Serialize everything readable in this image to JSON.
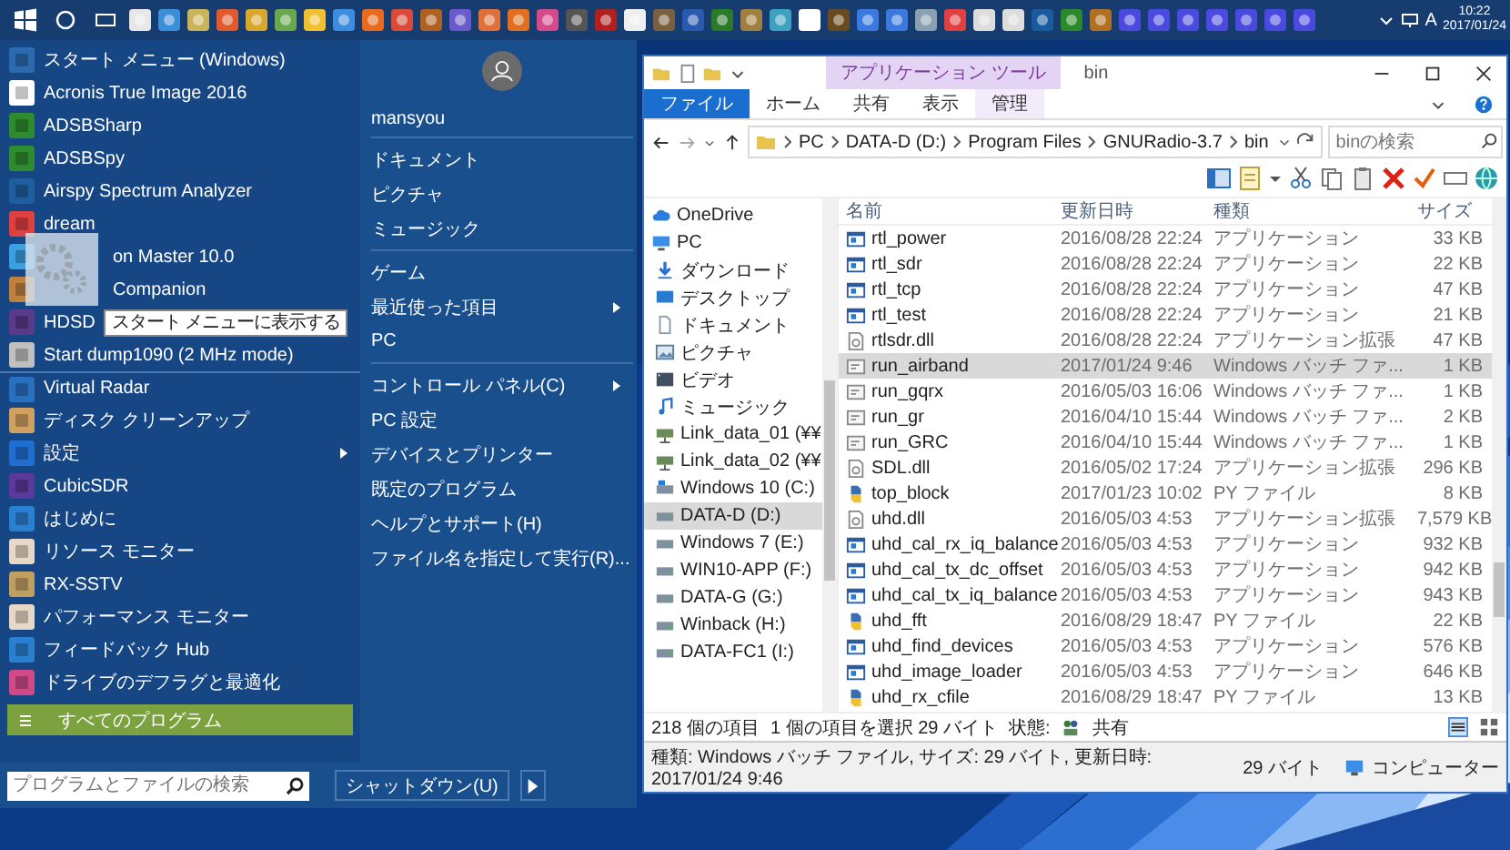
{
  "taskbar": {
    "ime": "A",
    "time": "10:22",
    "date": "2017/01/24"
  },
  "start_menu": {
    "programs": [
      {
        "label": "スタート メニュー (Windows)",
        "covered": false,
        "submenu": false
      },
      {
        "label": "Acronis True Image 2016",
        "covered": false,
        "submenu": false
      },
      {
        "label": "ADSBSharp",
        "covered": false,
        "submenu": false
      },
      {
        "label": "ADSBSpy",
        "covered": false,
        "submenu": false
      },
      {
        "label": "Airspy Spectrum Analyzer",
        "covered": false,
        "submenu": false
      },
      {
        "label": "dream",
        "covered": false,
        "submenu": false
      },
      {
        "label": "on Master 10.0",
        "covered": true,
        "submenu": false
      },
      {
        "label": "Companion",
        "covered": true,
        "submenu": false
      },
      {
        "label": "HDSD",
        "covered": false,
        "submenu": false,
        "tooltip": "スタート メニューに表示する"
      },
      {
        "label": "Start dump1090 (2 MHz mode)",
        "covered": false,
        "submenu": false
      },
      {
        "label": "Virtual Radar",
        "covered": false,
        "submenu": false
      },
      {
        "label": "ディスク クリーンアップ",
        "covered": false,
        "submenu": false
      },
      {
        "label": "設定",
        "covered": false,
        "submenu": true
      },
      {
        "label": "CubicSDR",
        "covered": false,
        "submenu": false
      },
      {
        "label": "はじめに",
        "covered": false,
        "submenu": false
      },
      {
        "label": "リソース モニター",
        "covered": false,
        "submenu": false
      },
      {
        "label": "RX-SSTV",
        "covered": false,
        "submenu": false
      },
      {
        "label": "パフォーマンス モニター",
        "covered": false,
        "submenu": false
      },
      {
        "label": "フィードバック Hub",
        "covered": false,
        "submenu": false
      },
      {
        "label": "ドライブのデフラグと最適化",
        "covered": false,
        "submenu": false
      }
    ],
    "user": "mansyou",
    "places": [
      [
        {
          "label": "ドキュメント",
          "submenu": false
        },
        {
          "label": "ピクチャ",
          "submenu": false
        },
        {
          "label": "ミュージック",
          "submenu": false
        }
      ],
      [
        {
          "label": "ゲーム",
          "submenu": false
        },
        {
          "label": "最近使った項目",
          "submenu": true
        },
        {
          "label": "PC",
          "submenu": false
        }
      ],
      [
        {
          "label": "コントロール パネル(C)",
          "submenu": true
        },
        {
          "label": "PC 設定",
          "submenu": false
        },
        {
          "label": "デバイスとプリンター",
          "submenu": false
        },
        {
          "label": "既定のプログラム",
          "submenu": false
        },
        {
          "label": "ヘルプとサポート(H)",
          "submenu": false
        },
        {
          "label": "ファイル名を指定して実行(R)...",
          "submenu": false
        }
      ]
    ],
    "all_programs": "すべてのプログラム",
    "search": {
      "placeholder": "プログラムとファイルの検索"
    },
    "shutdown": "シャットダウン(U)"
  },
  "explorer": {
    "context_tab": "アプリケーション ツール",
    "title": "bin",
    "tabs": [
      {
        "label": "ファイル",
        "selected": true
      },
      {
        "label": "ホーム",
        "selected": false
      },
      {
        "label": "共有",
        "selected": false
      },
      {
        "label": "表示",
        "selected": false
      },
      {
        "label": "管理",
        "selected": false
      }
    ],
    "path": [
      "PC",
      "DATA-D (D:)",
      "Program Files",
      "GNURadio-3.7",
      "bin"
    ],
    "search": {
      "placeholder": "binの検索"
    },
    "nav": [
      {
        "label": "OneDrive",
        "kind": "cloud",
        "selected": false
      },
      {
        "label": "PC",
        "kind": "pc",
        "selected": false,
        "children": [
          {
            "label": "ダウンロード",
            "kind": "download",
            "selected": false
          },
          {
            "label": "デスクトップ",
            "kind": "desktop",
            "selected": false
          },
          {
            "label": "ドキュメント",
            "kind": "document",
            "selected": false
          },
          {
            "label": "ピクチャ",
            "kind": "picture",
            "selected": false
          },
          {
            "label": "ビデオ",
            "kind": "video",
            "selected": false
          },
          {
            "label": "ミュージック",
            "kind": "music",
            "selected": false
          },
          {
            "label": "Link_data_01 (¥¥",
            "kind": "network",
            "selected": false
          },
          {
            "label": "Link_data_02 (¥¥",
            "kind": "network",
            "selected": false
          },
          {
            "label": "Windows 10 (C:)",
            "kind": "system",
            "selected": false
          },
          {
            "label": "DATA-D (D:)",
            "kind": "drive",
            "selected": true
          },
          {
            "label": "Windows 7 (E:)",
            "kind": "drive",
            "selected": false
          },
          {
            "label": "WIN10-APP (F:)",
            "kind": "drive",
            "selected": false
          },
          {
            "label": "DATA-G (G:)",
            "kind": "drive",
            "selected": false
          },
          {
            "label": "Winback (H:)",
            "kind": "drive",
            "selected": false
          },
          {
            "label": "DATA-FC1 (I:)",
            "kind": "drive",
            "selected": false
          }
        ]
      }
    ],
    "columns": [
      "名前",
      "更新日時",
      "種類",
      "サイズ"
    ],
    "files": [
      {
        "name": "rtl_power",
        "modified": "2016/08/28 22:24",
        "type": "アプリケーション",
        "size": "33 KB",
        "kind": "exe",
        "selected": false
      },
      {
        "name": "rtl_sdr",
        "modified": "2016/08/28 22:24",
        "type": "アプリケーション",
        "size": "22 KB",
        "kind": "exe",
        "selected": false
      },
      {
        "name": "rtl_tcp",
        "modified": "2016/08/28 22:24",
        "type": "アプリケーション",
        "size": "47 KB",
        "kind": "exe",
        "selected": false
      },
      {
        "name": "rtl_test",
        "modified": "2016/08/28 22:24",
        "type": "アプリケーション",
        "size": "21 KB",
        "kind": "exe",
        "selected": false
      },
      {
        "name": "rtlsdr.dll",
        "modified": "2016/08/28 22:24",
        "type": "アプリケーション拡張",
        "size": "47 KB",
        "kind": "dll",
        "selected": false
      },
      {
        "name": "run_airband",
        "modified": "2017/01/24 9:46",
        "type": "Windows バッチ ファ...",
        "size": "1 KB",
        "kind": "bat",
        "selected": true
      },
      {
        "name": "run_gqrx",
        "modified": "2016/05/03 16:06",
        "type": "Windows バッチ ファ...",
        "size": "1 KB",
        "kind": "bat",
        "selected": false
      },
      {
        "name": "run_gr",
        "modified": "2016/04/10 15:44",
        "type": "Windows バッチ ファ...",
        "size": "2 KB",
        "kind": "bat",
        "selected": false
      },
      {
        "name": "run_GRC",
        "modified": "2016/04/10 15:44",
        "type": "Windows バッチ ファ...",
        "size": "1 KB",
        "kind": "bat",
        "selected": false
      },
      {
        "name": "SDL.dll",
        "modified": "2016/05/02 17:24",
        "type": "アプリケーション拡張",
        "size": "296 KB",
        "kind": "dll",
        "selected": false
      },
      {
        "name": "top_block",
        "modified": "2017/01/23 10:02",
        "type": "PY ファイル",
        "size": "8 KB",
        "kind": "py",
        "selected": false
      },
      {
        "name": "uhd.dll",
        "modified": "2016/05/03 4:53",
        "type": "アプリケーション拡張",
        "size": "7,579 KB",
        "kind": "dll",
        "selected": false
      },
      {
        "name": "uhd_cal_rx_iq_balance",
        "modified": "2016/05/03 4:53",
        "type": "アプリケーション",
        "size": "932 KB",
        "kind": "exe",
        "selected": false
      },
      {
        "name": "uhd_cal_tx_dc_offset",
        "modified": "2016/05/03 4:53",
        "type": "アプリケーション",
        "size": "942 KB",
        "kind": "exe",
        "selected": false
      },
      {
        "name": "uhd_cal_tx_iq_balance",
        "modified": "2016/05/03 4:53",
        "type": "アプリケーション",
        "size": "943 KB",
        "kind": "exe",
        "selected": false
      },
      {
        "name": "uhd_fft",
        "modified": "2016/08/29 18:47",
        "type": "PY ファイル",
        "size": "22 KB",
        "kind": "py",
        "selected": false
      },
      {
        "name": "uhd_find_devices",
        "modified": "2016/05/03 4:53",
        "type": "アプリケーション",
        "size": "576 KB",
        "kind": "exe",
        "selected": false
      },
      {
        "name": "uhd_image_loader",
        "modified": "2016/05/03 4:53",
        "type": "アプリケーション",
        "size": "646 KB",
        "kind": "exe",
        "selected": false
      },
      {
        "name": "uhd_rx_cfile",
        "modified": "2016/08/29 18:47",
        "type": "PY ファイル",
        "size": "13 KB",
        "kind": "py",
        "selected": false
      }
    ],
    "status": {
      "count": "218 個の項目",
      "selection": "1 個の項目を選択 29 バイト",
      "state_label": "状態:",
      "state": "共有"
    },
    "details": {
      "info": "種類: Windows バッチ ファイル, サイズ: 29 バイト, 更新日時: 2017/01/24 9:46",
      "size": "29 バイト",
      "location": "コンピューター"
    }
  }
}
